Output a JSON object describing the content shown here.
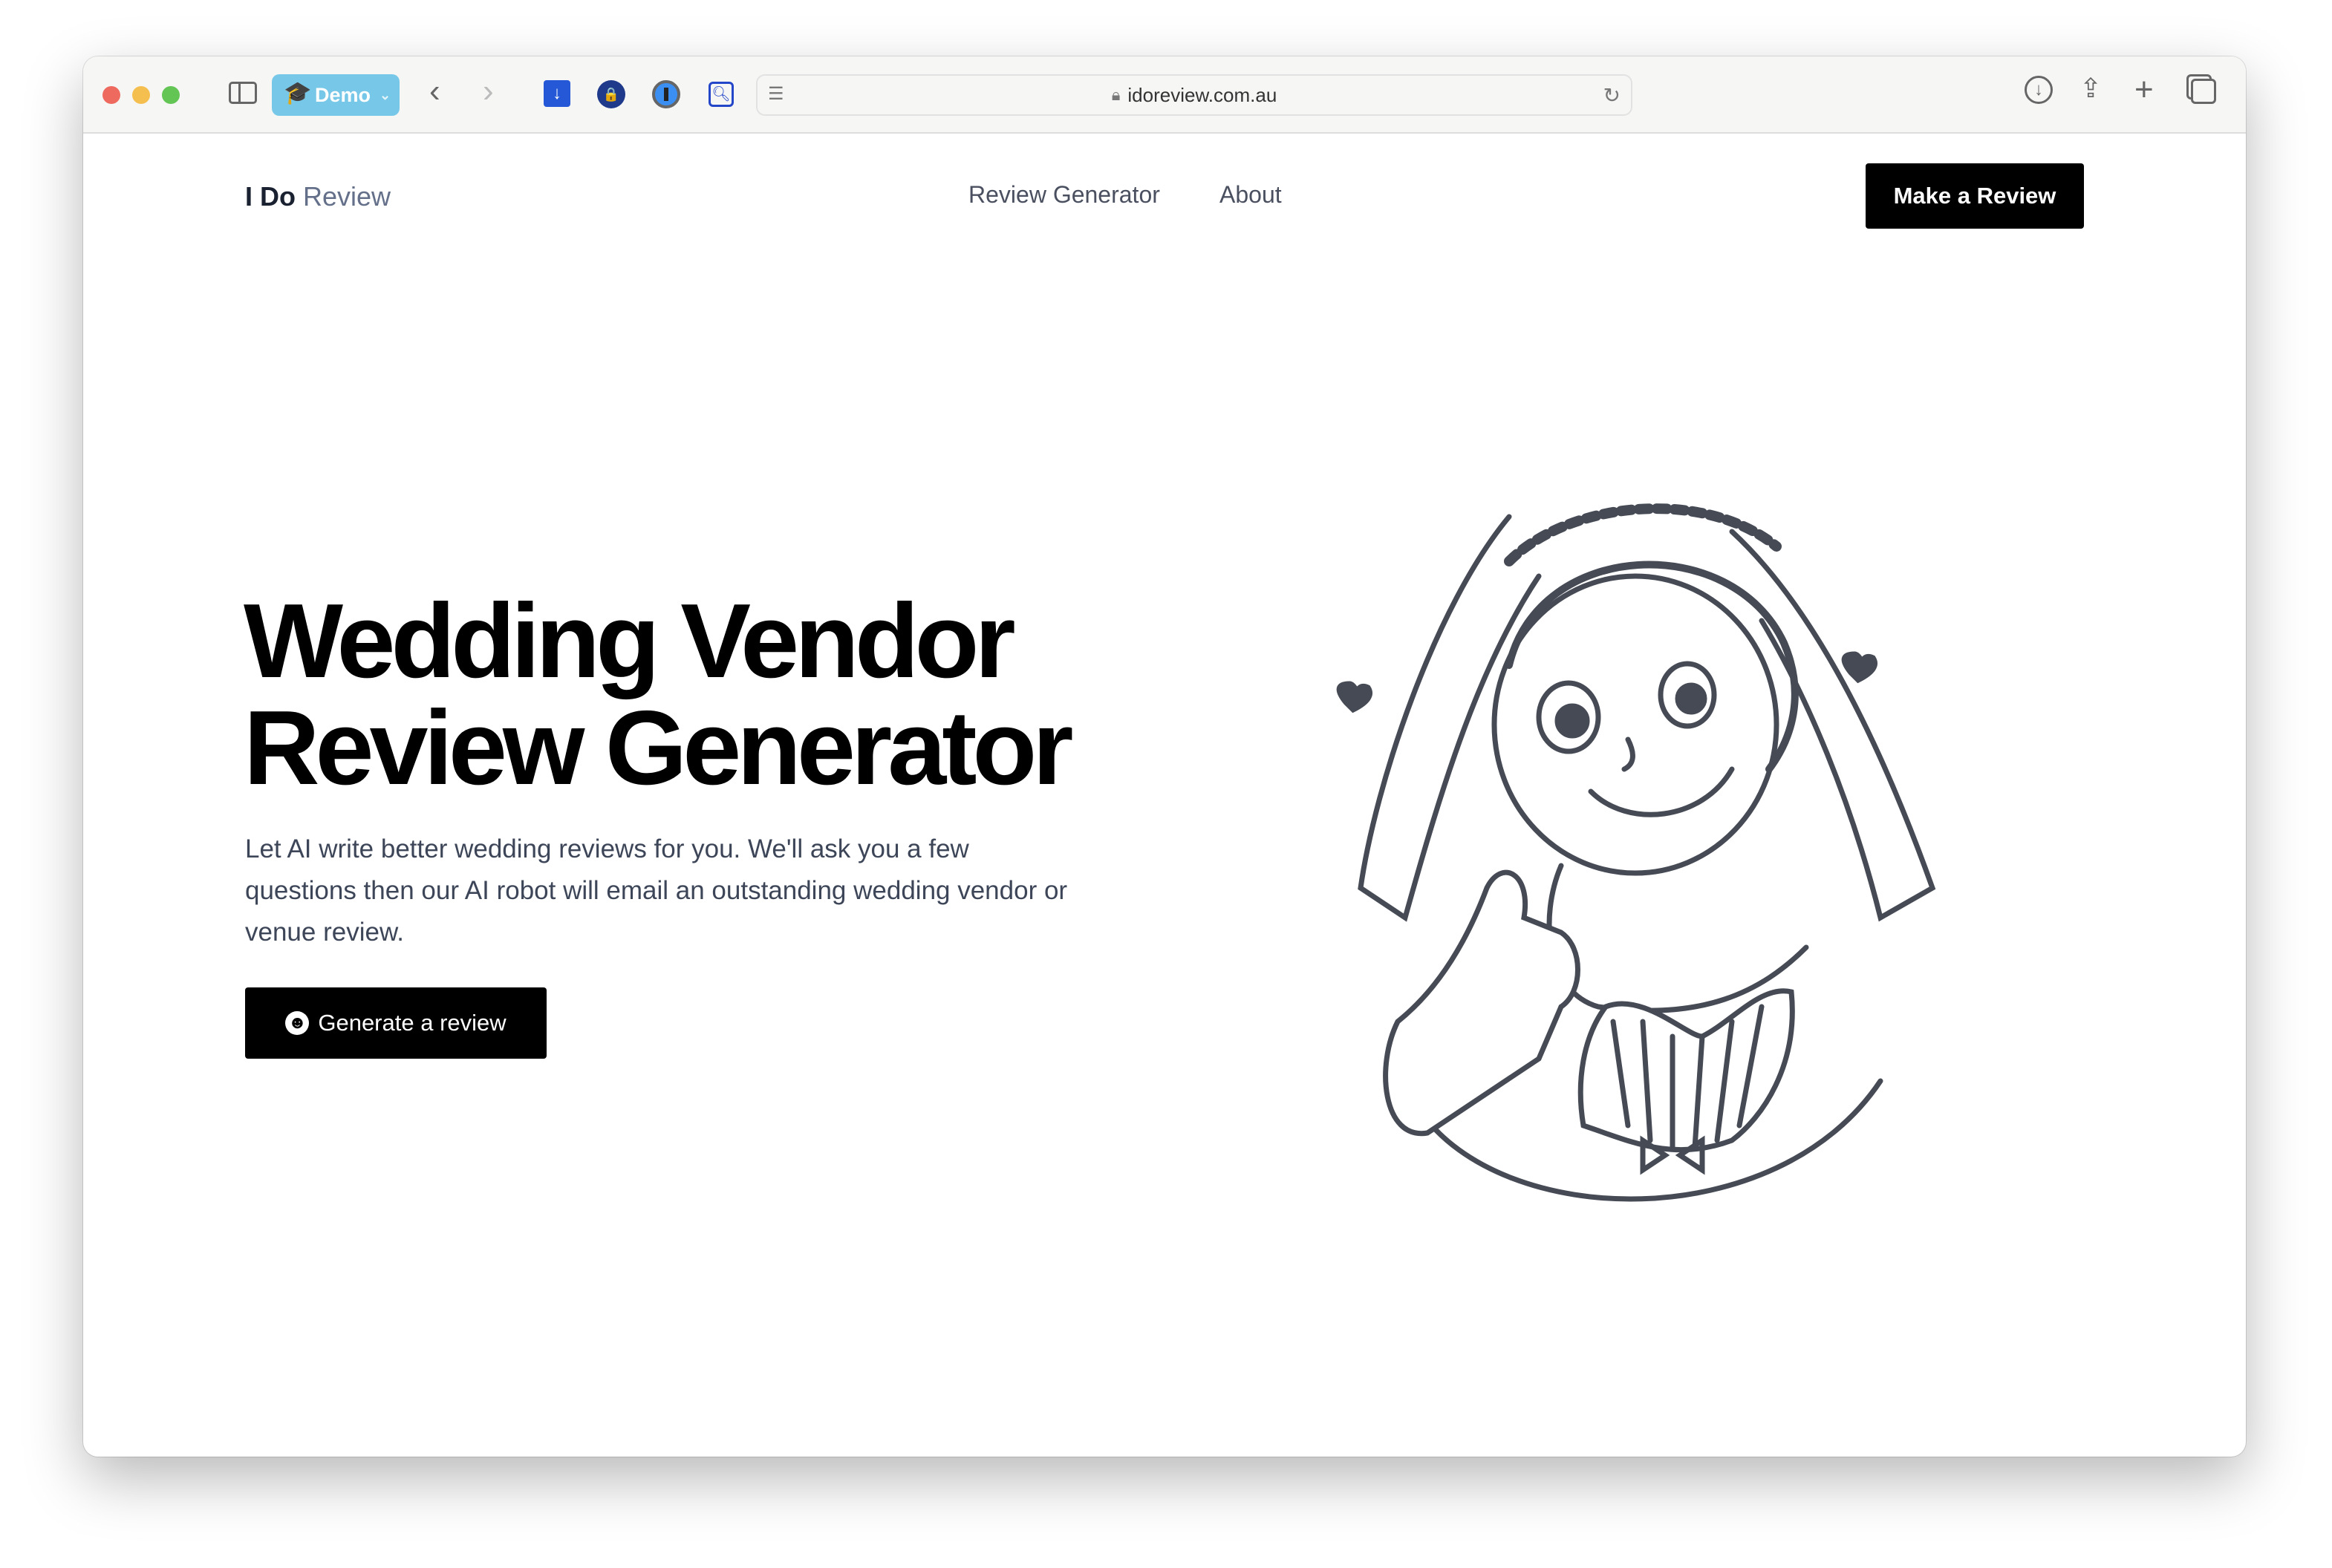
{
  "browser": {
    "profile_label": "Demo",
    "url": "idoreview.com.au",
    "icons": [
      "sidebar-icon",
      "back-icon",
      "forward-icon",
      "bitwarden-extension-icon",
      "privacy-extension-icon",
      "1password-extension-icon",
      "search-extension-icon",
      "reader-icon",
      "lock-icon",
      "reload-icon",
      "download-icon",
      "share-icon",
      "new-tab-icon",
      "tabs-overview-icon"
    ]
  },
  "site": {
    "logo_bold": "I Do",
    "logo_light": "Review",
    "nav": [
      {
        "label": "Review Generator"
      },
      {
        "label": "About"
      }
    ],
    "cta": "Make a Review"
  },
  "hero": {
    "title_line1": "Wedding Vendor",
    "title_line2": "Review Generator",
    "description": "Let AI write better wedding reviews for you. We'll ask you a few questions then our AI robot will email an outstanding wedding vendor or venue review.",
    "button": "Generate a review"
  },
  "colors": {
    "accent": "#000000",
    "profile": "#77c8e8",
    "illustration": "#454a55"
  }
}
